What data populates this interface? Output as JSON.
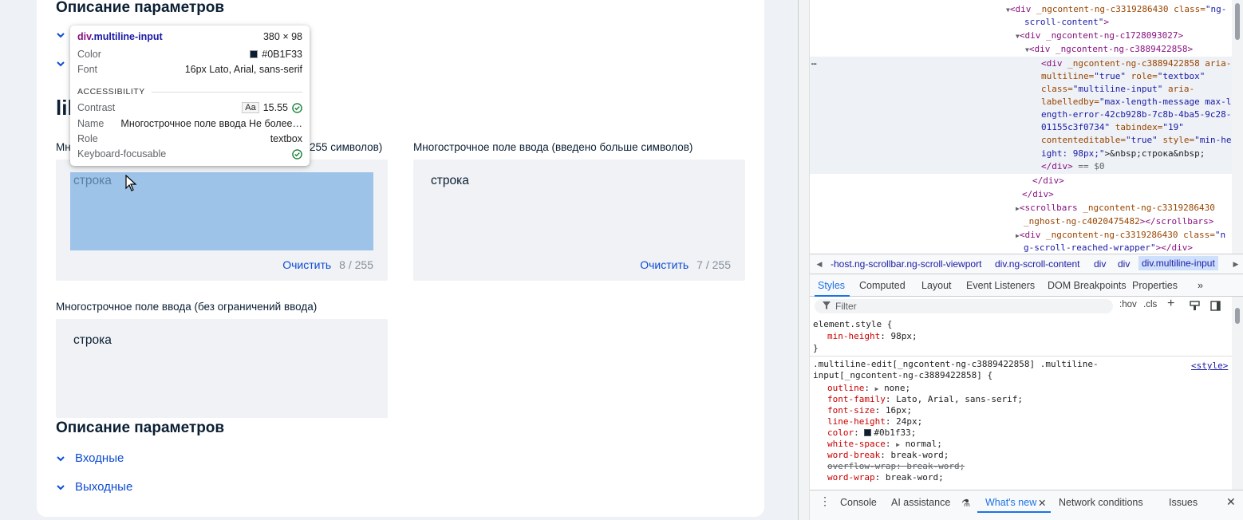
{
  "page": {
    "top_heading": "Описание параметров",
    "lib_heading_fragment": "lib",
    "field1_label_suffix": "255 символов)",
    "field1_label_prefix": "Мн",
    "field1_text": "строка",
    "field1_clear": "Очистить",
    "field1_count": "8 / 255",
    "field2_label": "Многострочное поле ввода (введено больше символов)",
    "field2_text": "строка",
    "field2_clear": "Очистить",
    "field2_count": "7 / 255",
    "field3_label": "Многострочное поле ввода (без ограничений ввода)",
    "field3_text": "строка",
    "bottom_heading": "Описание параметров",
    "acc_inputs": "Входные",
    "acc_outputs": "Выходные"
  },
  "tooltip": {
    "element": "div",
    "class": ".multiline-input",
    "size": "380 × 98",
    "color_label": "Color",
    "color_value": "#0B1F33",
    "font_label": "Font",
    "font_value": "16px Lato, Arial, sans-serif",
    "section": "ACCESSIBILITY",
    "contrast_label": "Contrast",
    "contrast_aa": "Aa",
    "contrast_value": "15.55",
    "name_label": "Name",
    "name_value": "Многострочное поле ввода Не более…",
    "role_label": "Role",
    "role_value": "textbox",
    "focus_label": "Keyboard-focusable"
  },
  "dom": {
    "l1_tag": "<div",
    "l1_attr": " _ngcontent-ng-c3319286430 class=",
    "l1_val": "\"ng-",
    "l1b_val": "scroll-content\"",
    "l1b_tag": ">",
    "l2": "<div _ngcontent-ng-c1728093027>",
    "l3": "<div _ngcontent-ng-c3889422858>",
    "ellipsis": "…",
    "s1_tag": "<div",
    "s1_attr": " _ngcontent-ng-c3889422858 aria-",
    "s2_attr": "multiline=",
    "s2_val": "\"true\"",
    "s2_attr2": " role=",
    "s2_val2": "\"textbox\"",
    "s3_attr": "class=",
    "s3_val": "\"multiline-input\"",
    "s3_attr2": " aria-",
    "s4_attr": "labelledby=",
    "s4_val": "\"max-length-message max-l",
    "s5_val": "ength-error-42cb928b-7c8b-4ba5-9c28-",
    "s6_val": "01155c3f0734\"",
    "s6_attr": " tabindex=",
    "s6_val2": "\"19\"",
    "s7_attr": "contenteditable=",
    "s7_val": "\"true\"",
    "s7_attr2": " style=",
    "s7_val2": "\"min-he",
    "s8_val": "ight: 98px;\"",
    "s8_plain": ">&nbsp;строка&nbsp;",
    "s9_tag": "</div>",
    "s9_plain": " == $0",
    "c1": "</div>",
    "c2": "</div>",
    "sb1_tag": "<scrollbars",
    "sb1_attr": " _ngcontent-ng-c3319286430",
    "sb2_attr": "_nghost-ng-c4020475482",
    "sb2_tag": "></scrollbars>",
    "w1_tag": "<div",
    "w1_attr": " _ngcontent-ng-c3319286430 class=",
    "w1_val": "\"n",
    "w2_val": "g-scroll-reached-wrapper\"",
    "w2_tag": "></div>"
  },
  "crumbs": [
    "-host.ng-scrollbar.ng-scroll-viewport",
    "div.ng-scroll-content",
    "div",
    "div",
    "div.multiline-input"
  ],
  "panel_tabs": [
    "Styles",
    "Computed",
    "Layout",
    "Event Listeners",
    "DOM Breakpoints",
    "Properties"
  ],
  "filter": {
    "placeholder": "Filter",
    "hov": ":hov",
    "cls": ".cls"
  },
  "styles": {
    "elem_selector": "element.style {",
    "elem_prop": "min-height",
    "elem_val": "98px;",
    "close1": "}",
    "rule_selector_1": ".multiline-edit[_ngcontent-ng-c3889422858] .multiline-",
    "rule_selector_2": "input[_ngcontent-ng-c3889422858] {",
    "rule_source": "<style>",
    "props": [
      {
        "name": "outline",
        "value": "none;"
      },
      {
        "name": "font-family",
        "value": "Lato, Arial, sans-serif;"
      },
      {
        "name": "font-size",
        "value": "16px;"
      },
      {
        "name": "line-height",
        "value": "24px;"
      },
      {
        "name": "color",
        "value": "#0b1f33;"
      },
      {
        "name": "white-space",
        "value": "normal;"
      },
      {
        "name": "word-break",
        "value": "break-word;"
      },
      {
        "name": "overflow-wrap",
        "value": "break-word;"
      },
      {
        "name": "word-wrap",
        "value": "break-word;"
      }
    ]
  },
  "drawer": [
    "Console",
    "AI assistance",
    "What's new",
    "Network conditions",
    "Issues"
  ],
  "colors": {
    "accent": "#0d4cd3",
    "text": "#0b1f33",
    "highlight": "#9ec3e8",
    "devtools_blue": "#1a73e8"
  }
}
